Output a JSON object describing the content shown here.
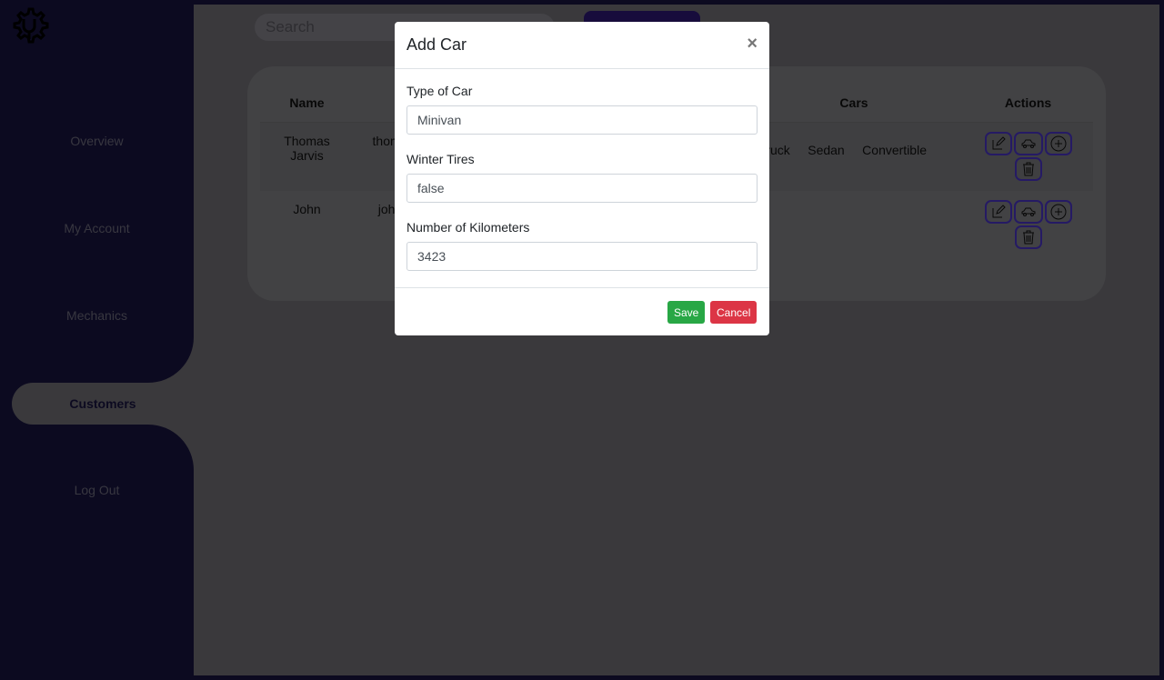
{
  "sidebar": {
    "items": [
      {
        "label": "Overview"
      },
      {
        "label": "My Account"
      },
      {
        "label": "Mechanics"
      },
      {
        "label": "Customers",
        "active": true
      },
      {
        "label": "Log Out"
      }
    ]
  },
  "search": {
    "placeholder": "Search"
  },
  "table": {
    "headers": [
      "Name",
      "",
      "",
      "",
      "Cars",
      "Actions"
    ],
    "rows": [
      {
        "name": "Thomas Jarvis",
        "email": "thoma",
        "cars": [
          "Truck",
          "Sedan",
          "Convertible"
        ]
      },
      {
        "name": "John",
        "email": "john",
        "cars": []
      }
    ]
  },
  "modal": {
    "title": "Add Car",
    "close": "×",
    "fields": [
      {
        "label": "Type of Car",
        "value": "Minivan"
      },
      {
        "label": "Winter Tires",
        "value": "false"
      },
      {
        "label": "Number of Kilometers",
        "value": "3423"
      }
    ],
    "save": "Save",
    "cancel": "Cancel"
  },
  "colors": {
    "sidebar": "#181440",
    "save": "#28a745",
    "cancel": "#dc3545",
    "accent": "#4a34c8"
  }
}
